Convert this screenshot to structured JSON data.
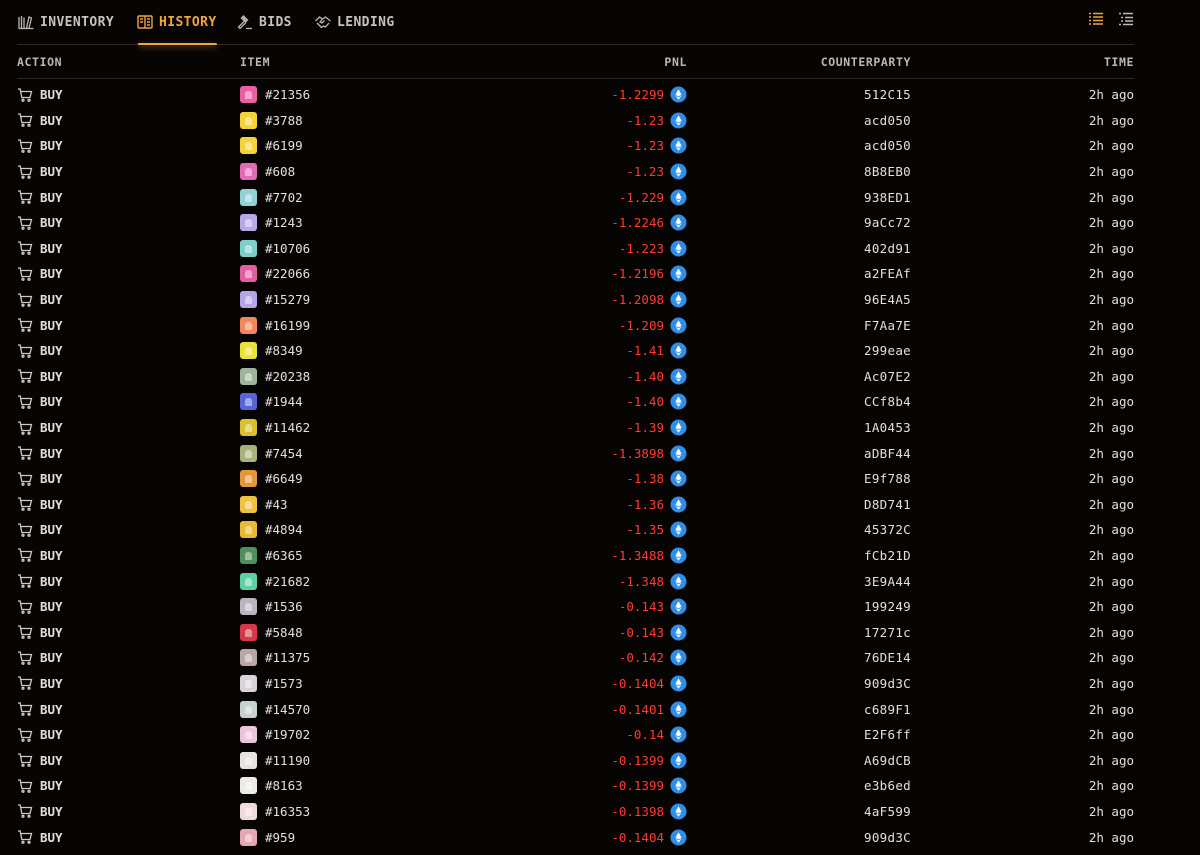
{
  "tabs": [
    {
      "label": "INVENTORY",
      "icon": "inventory-books-icon",
      "active": false
    },
    {
      "label": "HISTORY",
      "icon": "history-book-icon",
      "active": true
    },
    {
      "label": "BIDS",
      "icon": "gavel-icon",
      "active": false
    },
    {
      "label": "LENDING",
      "icon": "handshake-icon",
      "active": false
    }
  ],
  "view_toggles": [
    {
      "icon": "detailed-list-icon",
      "active": true
    },
    {
      "icon": "compact-list-icon",
      "active": false
    }
  ],
  "columns": {
    "action": "ACTION",
    "item": "ITEM",
    "pnl": "PNL",
    "counterparty": "COUNTERPARTY",
    "time": "TIME"
  },
  "colors": {
    "accent": "#f2a53b",
    "negative": "#ff3b30",
    "eth_badge": "#2f8fe8",
    "background": "#070404"
  },
  "rows": [
    {
      "action": "BUY",
      "item": "#21356",
      "pnl": "-1.2299",
      "counterparty": "512C15",
      "time": "2h ago",
      "thumb_color": "#e85fa6"
    },
    {
      "action": "BUY",
      "item": "#3788",
      "pnl": "-1.23",
      "counterparty": "acd050",
      "time": "2h ago",
      "thumb_color": "#f4d23a"
    },
    {
      "action": "BUY",
      "item": "#6199",
      "pnl": "-1.23",
      "counterparty": "acd050",
      "time": "2h ago",
      "thumb_color": "#f4d23a"
    },
    {
      "action": "BUY",
      "item": "#608",
      "pnl": "-1.23",
      "counterparty": "8B8EB0",
      "time": "2h ago",
      "thumb_color": "#e36ab5"
    },
    {
      "action": "BUY",
      "item": "#7702",
      "pnl": "-1.229",
      "counterparty": "938ED1",
      "time": "2h ago",
      "thumb_color": "#8fd3d6"
    },
    {
      "action": "BUY",
      "item": "#1243",
      "pnl": "-1.2246",
      "counterparty": "9aCc72",
      "time": "2h ago",
      "thumb_color": "#b7a8e6"
    },
    {
      "action": "BUY",
      "item": "#10706",
      "pnl": "-1.223",
      "counterparty": "402d91",
      "time": "2h ago",
      "thumb_color": "#7fcfc9"
    },
    {
      "action": "BUY",
      "item": "#22066",
      "pnl": "-1.2196",
      "counterparty": "a2FEAf",
      "time": "2h ago",
      "thumb_color": "#e05fa3"
    },
    {
      "action": "BUY",
      "item": "#15279",
      "pnl": "-1.2098",
      "counterparty": "96E4A5",
      "time": "2h ago",
      "thumb_color": "#b7a4e4"
    },
    {
      "action": "BUY",
      "item": "#16199",
      "pnl": "-1.209",
      "counterparty": "F7Aa7E",
      "time": "2h ago",
      "thumb_color": "#f2865c"
    },
    {
      "action": "BUY",
      "item": "#8349",
      "pnl": "-1.41",
      "counterparty": "299eae",
      "time": "2h ago",
      "thumb_color": "#e8e23a"
    },
    {
      "action": "BUY",
      "item": "#20238",
      "pnl": "-1.40",
      "counterparty": "Ac07E2",
      "time": "2h ago",
      "thumb_color": "#9fb59a"
    },
    {
      "action": "BUY",
      "item": "#1944",
      "pnl": "-1.40",
      "counterparty": "CCf8b4",
      "time": "2h ago",
      "thumb_color": "#5a63d8"
    },
    {
      "action": "BUY",
      "item": "#11462",
      "pnl": "-1.39",
      "counterparty": "1A0453",
      "time": "2h ago",
      "thumb_color": "#d9c02c"
    },
    {
      "action": "BUY",
      "item": "#7454",
      "pnl": "-1.3898",
      "counterparty": "aDBF44",
      "time": "2h ago",
      "thumb_color": "#a8b27a"
    },
    {
      "action": "BUY",
      "item": "#6649",
      "pnl": "-1.38",
      "counterparty": "E9f788",
      "time": "2h ago",
      "thumb_color": "#e6963c"
    },
    {
      "action": "BUY",
      "item": "#43",
      "pnl": "-1.36",
      "counterparty": "D8D741",
      "time": "2h ago",
      "thumb_color": "#f0c244"
    },
    {
      "action": "BUY",
      "item": "#4894",
      "pnl": "-1.35",
      "counterparty": "45372C",
      "time": "2h ago",
      "thumb_color": "#e8b934"
    },
    {
      "action": "BUY",
      "item": "#6365",
      "pnl": "-1.3488",
      "counterparty": "fCb21D",
      "time": "2h ago",
      "thumb_color": "#4f8f5c"
    },
    {
      "action": "BUY",
      "item": "#21682",
      "pnl": "-1.348",
      "counterparty": "3E9A44",
      "time": "2h ago",
      "thumb_color": "#5fcfa4"
    },
    {
      "action": "BUY",
      "item": "#1536",
      "pnl": "-0.143",
      "counterparty": "199249",
      "time": "2h ago",
      "thumb_color": "#b8b4c0"
    },
    {
      "action": "BUY",
      "item": "#5848",
      "pnl": "-0.143",
      "counterparty": "17271c",
      "time": "2h ago",
      "thumb_color": "#d23a4a"
    },
    {
      "action": "BUY",
      "item": "#11375",
      "pnl": "-0.142",
      "counterparty": "76DE14",
      "time": "2h ago",
      "thumb_color": "#b9a7a7"
    },
    {
      "action": "BUY",
      "item": "#1573",
      "pnl": "-0.1404",
      "counterparty": "909d3C",
      "time": "2h ago",
      "thumb_color": "#d7d3d8"
    },
    {
      "action": "BUY",
      "item": "#14570",
      "pnl": "-0.1401",
      "counterparty": "c689F1",
      "time": "2h ago",
      "thumb_color": "#c5d2cd"
    },
    {
      "action": "BUY",
      "item": "#19702",
      "pnl": "-0.14",
      "counterparty": "E2F6ff",
      "time": "2h ago",
      "thumb_color": "#e9c6de"
    },
    {
      "action": "BUY",
      "item": "#11190",
      "pnl": "-0.1399",
      "counterparty": "A69dCB",
      "time": "2h ago",
      "thumb_color": "#e8e2e2"
    },
    {
      "action": "BUY",
      "item": "#8163",
      "pnl": "-0.1399",
      "counterparty": "e3b6ed",
      "time": "2h ago",
      "thumb_color": "#ecebe6"
    },
    {
      "action": "BUY",
      "item": "#16353",
      "pnl": "-0.1398",
      "counterparty": "4aF599",
      "time": "2h ago",
      "thumb_color": "#efd9dc"
    },
    {
      "action": "BUY",
      "item": "#959",
      "pnl": "-0.1404",
      "counterparty": "909d3C",
      "time": "2h ago",
      "thumb_color": "#e6a7b2"
    }
  ]
}
